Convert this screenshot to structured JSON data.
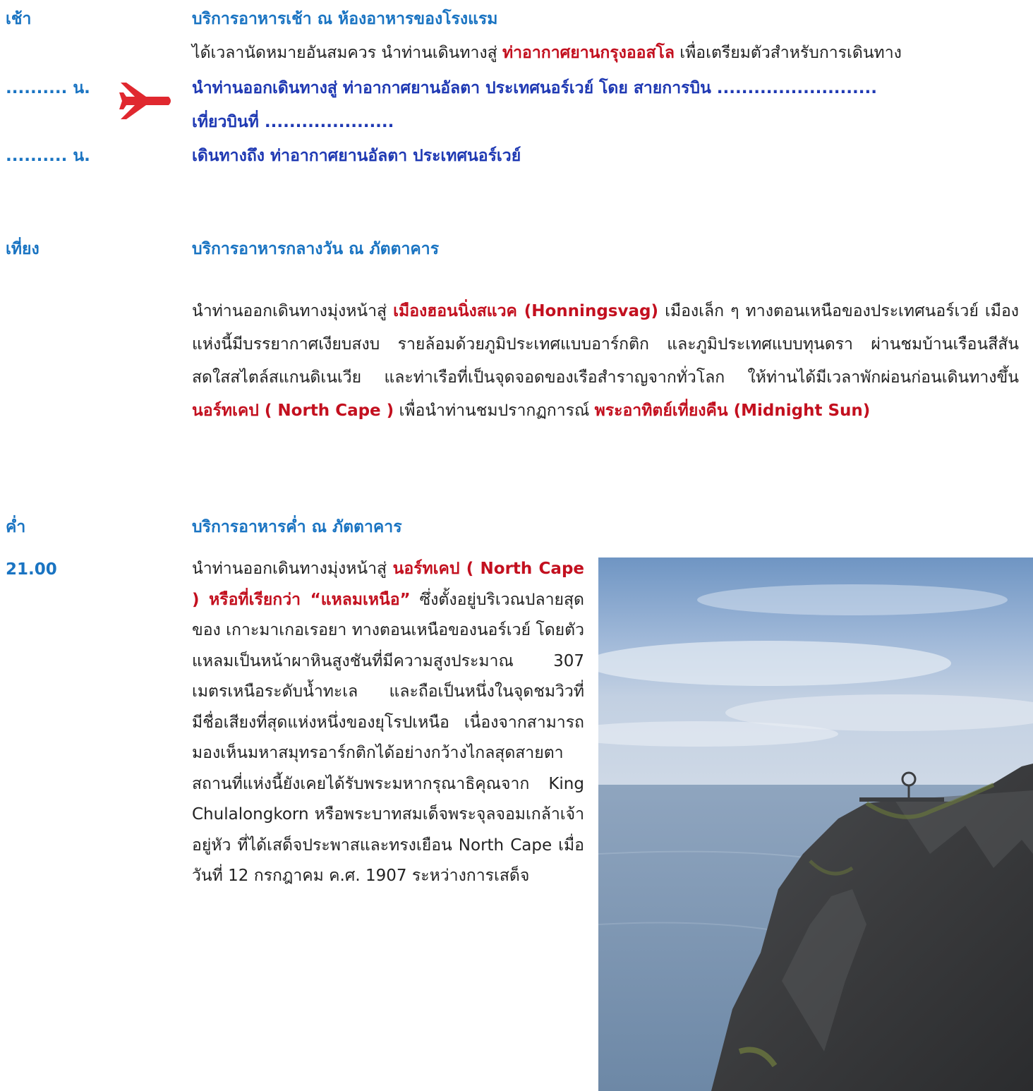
{
  "colors": {
    "label_blue": "#1a74c2",
    "flight_navy": "#1f39b3",
    "highlight_red": "#c3101f",
    "plane_red": "#e0282f"
  },
  "breakfast": {
    "time": "เช้า",
    "title": "บริการอาหารเช้า ณ ห้องอาหารของโรงแรม",
    "line_pre": "ได้เวลานัดหมายอันสมควร นำท่านเดินทางสู่ ",
    "line_red": "ท่าอากาศยานกรุงออสโล",
    "line_post": " เพื่อเตรียมตัวสำหรับการเดินทาง"
  },
  "flight": {
    "time": ".......... น.",
    "icon": "airplane-icon",
    "line1": "นำท่านออกเดินทางสู่ ท่าอากาศยานอัลตา ประเทศนอร์เวย์ โดย สายการบิน ..........................",
    "line2": "เที่ยวบินที่ ....................."
  },
  "arrival": {
    "time": ".......... น.",
    "text": "เดินทางถึง ท่าอากาศยานอัลตา ประเทศนอร์เวย์"
  },
  "lunch": {
    "time": "เที่ยง",
    "title": "บริการอาหารกลางวัน ณ ภัตตาคาร",
    "p_pre": "นำท่านออกเดินทางมุ่งหน้าสู่ ",
    "p_red1": "เมืองฮอนนิ่งสแวค (Honningsvag)",
    "p_mid": " เมืองเล็ก ๆ ทางตอนเหนือของประเทศนอร์เวย์ เมืองแห่งนี้มีบรรยากาศเงียบสงบ รายล้อมด้วยภูมิประเทศแบบอาร์กติก และภูมิประเทศแบบทุนดรา ผ่านชมบ้านเรือนสีสันสดใสสไตล์สแกนดิเนเวีย และท่าเรือที่เป็นจุดจอดของเรือสำราญจากทั่วโลก ให้ท่านได้มีเวลาพักผ่อนก่อนเดินทางขึ้น ",
    "p_red2": "นอร์ทเคป ( North Cape )",
    "p_mid2": " เพื่อนำท่านชมปรากฏการณ์ ",
    "p_red3": "พระอาทิตย์เที่ยงคืน (Midnight Sun)"
  },
  "dinner": {
    "time": "ค่ำ",
    "title": "บริการอาหารค่ำ ณ ภัตตาคาร"
  },
  "evening": {
    "time": "21.00",
    "pre": "นำท่านออกเดินทางมุ่งหน้าสู่ ",
    "red": "นอร์ทเคป ( North Cape ) หรือที่เรียกว่า “แหลมเหนือ”",
    "body": " ซึ่งตั้งอยู่บริเวณปลายสุดของ เกาะมาเกอเรอยา ทางตอนเหนือของนอร์เวย์ โดยตัวแหลมเป็นหน้าผาหินสูงชันที่มีความสูงประมาณ 307 เมตรเหนือระดับน้ำทะเล และถือเป็นหนึ่งในจุดชมวิวที่มีชื่อเสียงที่สุดแห่งหนึ่งของยุโรปเหนือ เนื่องจากสามารถมองเห็นมหาสมุทรอาร์กติกได้อย่างกว้างไกลสุดสายตา สถานที่แห่งนี้ยังเคยได้รับพระมหากรุณาธิคุณจาก King Chulalongkorn หรือพระบาทสมเด็จพระจุลจอมเกล้าเจ้าอยู่หัว ที่ได้เสด็จประพาสและทรงเยือน North Cape เมื่อวันที่ 12 กรกฎาคม ค.ศ. 1907 ระหว่างการเสด็จ"
  }
}
